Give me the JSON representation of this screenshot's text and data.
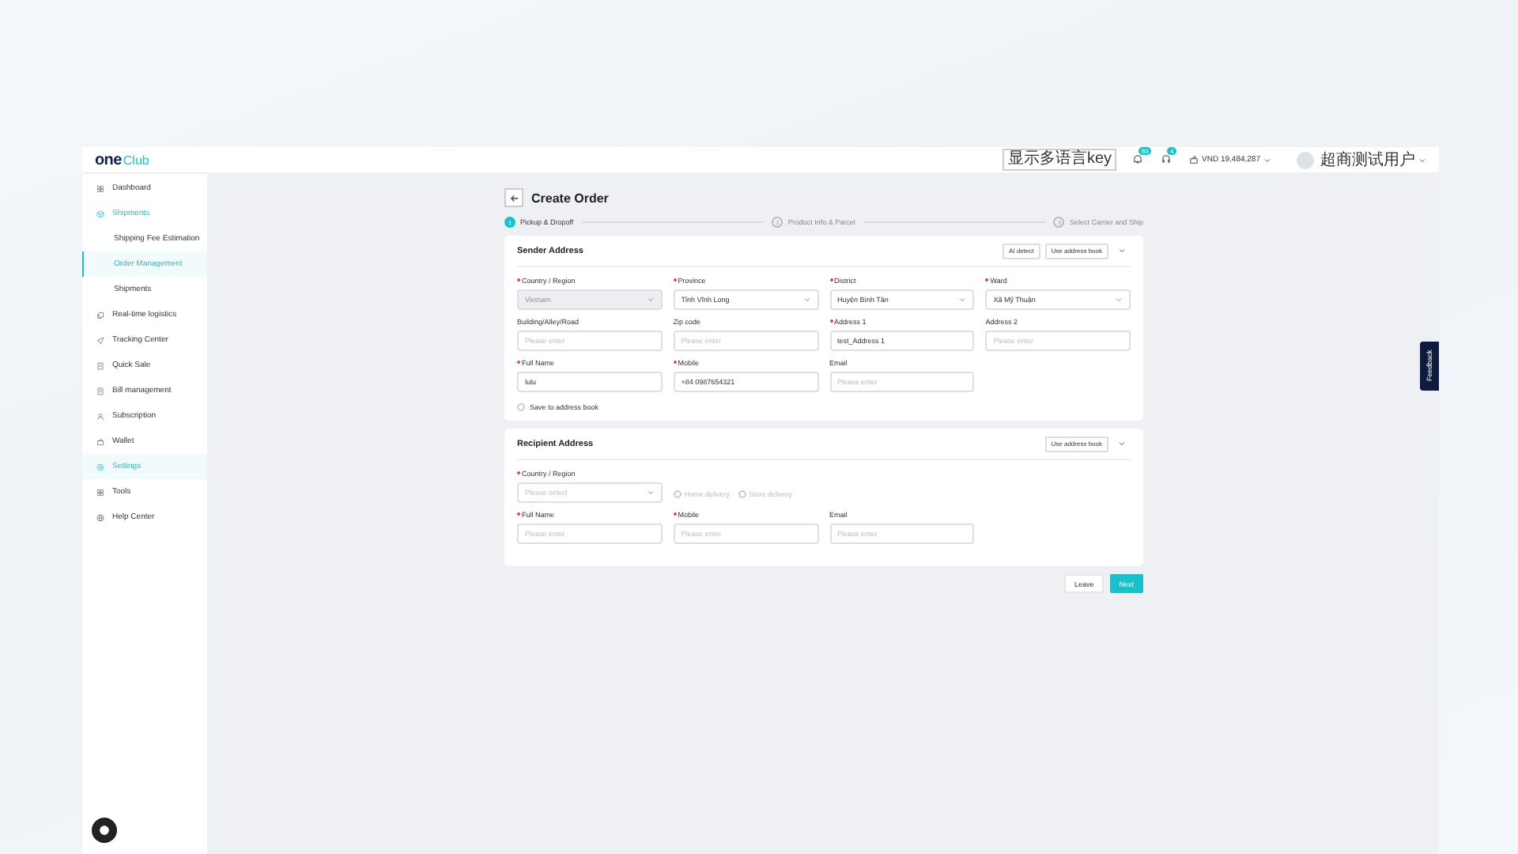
{
  "header": {
    "logo": {
      "prefix": "one",
      "suffix": "Club"
    },
    "language_button": "显示多语言key",
    "notifications_badge": "86",
    "messages_badge": "4",
    "balance": "VND 19,484,287",
    "user_name": "超商测试用户"
  },
  "sidebar": {
    "items": [
      {
        "label": "Dashboard",
        "selected": false
      },
      {
        "label": "Shipments",
        "selected": true,
        "children": [
          {
            "label": "Shipping Fee Estimation",
            "selected": false
          },
          {
            "label": "Order Management",
            "selected": true
          },
          {
            "label": "Shipments",
            "selected": false
          }
        ]
      },
      {
        "label": "Real-time logistics",
        "selected": false
      },
      {
        "label": "Tracking Center",
        "selected": false
      },
      {
        "label": "Quick Sale",
        "selected": false
      },
      {
        "label": "Bill management",
        "selected": false
      },
      {
        "label": "Subscription",
        "selected": false
      },
      {
        "label": "Wallet",
        "selected": false
      },
      {
        "label": "Settings",
        "selected": true
      },
      {
        "label": "Tools",
        "selected": false
      },
      {
        "label": "Help Center",
        "selected": false
      }
    ]
  },
  "page": {
    "title": "Create Order",
    "steps": [
      {
        "number": "1",
        "label": "Pickup & Dropoff",
        "selected": true
      },
      {
        "number": "2",
        "label": "Product Info & Parcel",
        "selected": false
      },
      {
        "number": "3",
        "label": "Select Carrier and Ship",
        "selected": false
      }
    ],
    "sender": {
      "title": "Sender Address",
      "ai_button": "AI detect",
      "address_book_button": "Use address book",
      "fields": [
        {
          "label": "Country / Region",
          "required": true,
          "kind": "select",
          "value": "Vietnam",
          "disabled": true
        },
        {
          "label": "Province",
          "required": true,
          "kind": "select",
          "value": "Tỉnh Vĩnh Long",
          "disabled": false
        },
        {
          "label": "District",
          "required": true,
          "kind": "select",
          "value": "Huyện Bình Tân",
          "disabled": false
        },
        {
          "label": "Ward",
          "required": true,
          "kind": "select",
          "value": "Xã Mỹ Thuận",
          "disabled": false
        },
        {
          "label": "Building/Alley/Road",
          "required": false,
          "kind": "input",
          "placeholder": "Please enter"
        },
        {
          "label": "Zip code",
          "required": false,
          "kind": "input",
          "placeholder": "Please enter"
        },
        {
          "label": "Address 1",
          "required": true,
          "kind": "input",
          "value": "test_Address 1"
        },
        {
          "label": "Address 2",
          "required": false,
          "kind": "input",
          "placeholder": "Please enter"
        },
        {
          "label": "Full Name",
          "required": true,
          "kind": "input",
          "value": "lulu"
        },
        {
          "label": "Mobile",
          "required": true,
          "kind": "input",
          "value": "+84 0987654321"
        },
        {
          "label": "Email",
          "required": false,
          "kind": "input",
          "placeholder": "Please enter"
        }
      ],
      "save_checkbox": {
        "label": "Save to address book",
        "checked": false
      }
    },
    "recipient": {
      "title": "Recipient Address",
      "address_book_button": "Use address book",
      "country": {
        "label": "Country / Region",
        "required": true,
        "placeholder": "Please select"
      },
      "delivery_options": [
        {
          "label": "Home delivery",
          "selected": false,
          "disabled": true
        },
        {
          "label": "Store delivery",
          "selected": false,
          "disabled": true
        }
      ],
      "fields": [
        {
          "label": "Full Name",
          "required": true,
          "placeholder": "Please enter"
        },
        {
          "label": "Mobile",
          "required": true,
          "placeholder": "Please enter"
        },
        {
          "label": "Email",
          "required": false,
          "placeholder": "Please enter"
        }
      ]
    },
    "buttons": {
      "leave": "Leave",
      "next": "Next"
    }
  },
  "feedback_tab": "Feedback"
}
